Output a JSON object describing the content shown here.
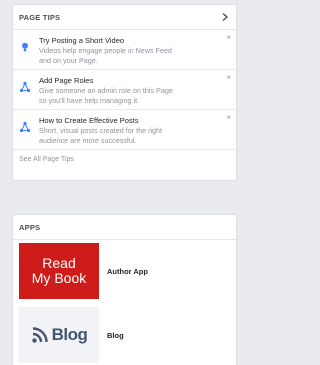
{
  "tips": {
    "header": "PAGE TIPS",
    "items": [
      {
        "title": "Try Posting a Short Video",
        "desc_line1": "Videos help engage people in News Feed",
        "desc_line2": "and on your Page.",
        "icon": "lightbulb-icon"
      },
      {
        "title": "Add Page Roles",
        "desc_line1": "Give someone an admin role on this Page",
        "desc_line2": "so you'll have help managing it.",
        "icon": "network-icon"
      },
      {
        "title": "How to Create Effective Posts",
        "desc_line1": "Short, visual posts created for the right",
        "desc_line2": "audience are more successful.",
        "icon": "network-icon"
      }
    ],
    "close_glyph": "×",
    "see_all": "See All Page Tips"
  },
  "apps": {
    "header": "APPS",
    "items": [
      {
        "name": "Author App",
        "thumb_line1": "Read",
        "thumb_line2": "My Book"
      },
      {
        "name": "Blog",
        "thumb_text": "Blog",
        "thumb_icon": "rss-icon"
      }
    ]
  },
  "colors": {
    "accent": "#4080ff",
    "thumb_red": "#ce1c1a",
    "muted_text": "#90949c"
  }
}
